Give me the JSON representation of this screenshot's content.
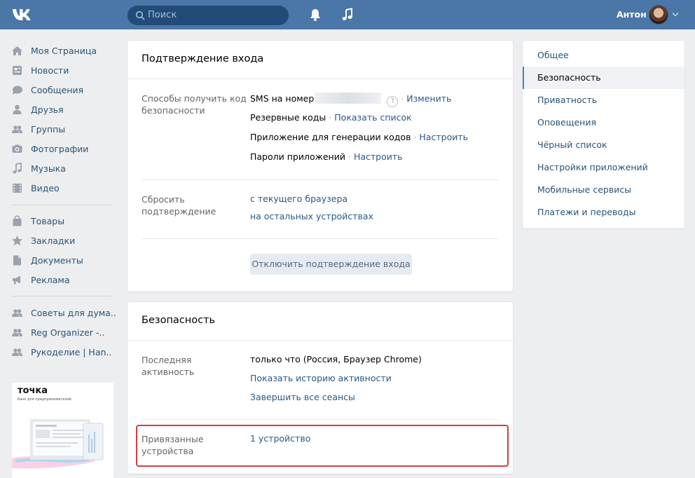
{
  "header": {
    "search_placeholder": "Поиск",
    "user_name": "Антон"
  },
  "nav": {
    "primary": [
      {
        "label": "Моя Страница",
        "icon": "home-icon"
      },
      {
        "label": "Новости",
        "icon": "news-icon"
      },
      {
        "label": "Сообщения",
        "icon": "messages-icon"
      },
      {
        "label": "Друзья",
        "icon": "friends-icon"
      },
      {
        "label": "Группы",
        "icon": "groups-icon"
      },
      {
        "label": "Фотографии",
        "icon": "camera-icon"
      },
      {
        "label": "Музыка",
        "icon": "music-icon"
      },
      {
        "label": "Видео",
        "icon": "video-icon"
      }
    ],
    "secondary": [
      {
        "label": "Товары",
        "icon": "bag-icon"
      },
      {
        "label": "Закладки",
        "icon": "star-icon"
      },
      {
        "label": "Документы",
        "icon": "document-icon"
      },
      {
        "label": "Реклама",
        "icon": "megaphone-icon"
      }
    ],
    "groups": [
      {
        "label": "Советы для дума..",
        "icon": "group-icon"
      },
      {
        "label": "Reg Organizer -..",
        "icon": "group-icon"
      },
      {
        "label": "Рукоделие | Han..",
        "icon": "group-icon"
      }
    ]
  },
  "ad": {
    "brand": "точка",
    "subtitle": "банк для предпринимателей"
  },
  "login_confirm": {
    "title": "Подтверждение входа",
    "methods_label": "Способы получить код безопасности",
    "sms_text": "SMS на номер",
    "help_glyph": "?",
    "change_link": "Изменить",
    "backup_codes": "Резервные коды",
    "show_list_link": "Показать список",
    "app_text": "Приложение для генерации кодов",
    "setup_link_1": "Настроить",
    "app_passwords": "Пароли приложений",
    "setup_link_2": "Настроить",
    "reset_label": "Сбросить подтверждение",
    "reset_current": "с текущего браузера",
    "reset_others": "на остальных устройствах",
    "disable_button": "Отключить подтверждение входа"
  },
  "security": {
    "title": "Безопасность",
    "last_activity_label": "Последняя активность",
    "last_activity_value": "только что (Россия, Браузер Chrome)",
    "show_history_link": "Показать историю активности",
    "end_sessions_link": "Завершить все сеансы",
    "devices_label": "Привязанные устройства",
    "devices_value": "1 устройство"
  },
  "settings_menu": {
    "items": [
      "Общее",
      "Безопасность",
      "Приватность",
      "Оповещения",
      "Чёрный список",
      "Настройки приложений",
      "Мобильные сервисы",
      "Платежи и переводы"
    ],
    "active_index": 1
  },
  "colors": {
    "header": "#4a76a8",
    "link": "#2a5885",
    "highlight": "#d13f3f"
  }
}
